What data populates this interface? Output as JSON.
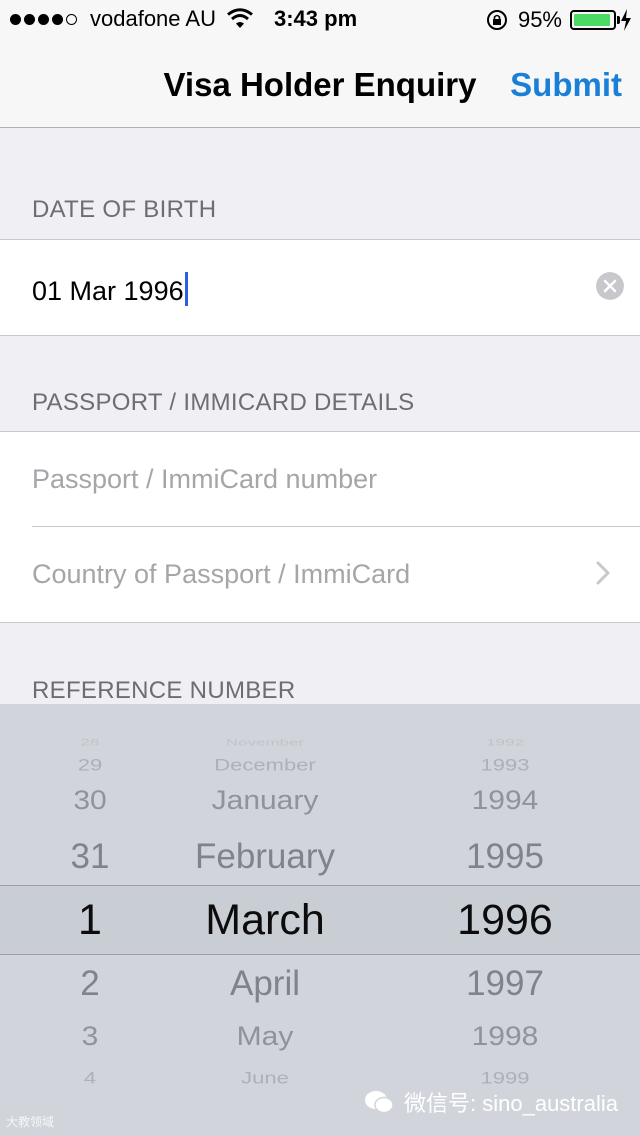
{
  "status_bar": {
    "carrier": "vodafone AU",
    "time": "3:43 pm",
    "battery_percent": "95%",
    "battery_level": 0.95,
    "signal_bars": 4,
    "signal_max": 5,
    "icons": [
      "signal-dots-icon",
      "wifi-icon",
      "rotation-lock-icon",
      "battery-icon",
      "charging-bolt-icon"
    ]
  },
  "nav": {
    "title": "Visa Holder Enquiry",
    "submit_label": "Submit",
    "accent_color": "#1a7fd6"
  },
  "sections": {
    "dob": {
      "header": "DATE OF BIRTH",
      "value": "01 Mar 1996",
      "clear_icon": "clear-icon"
    },
    "passport": {
      "header": "PASSPORT / IMMICARD DETAILS",
      "number_placeholder": "Passport / ImmiCard number",
      "country_placeholder": "Country of Passport / ImmiCard",
      "chevron_icon": "chevron-right-icon"
    },
    "reference": {
      "header": "REFERENCE NUMBER"
    }
  },
  "picker": {
    "days": [
      "28",
      "29",
      "30",
      "31",
      "1",
      "2",
      "3",
      "4"
    ],
    "months": [
      "November",
      "December",
      "January",
      "February",
      "March",
      "April",
      "May",
      "June"
    ],
    "years": [
      "1992",
      "1993",
      "1994",
      "1995",
      "1996",
      "1997",
      "1998",
      "1999"
    ],
    "selected": {
      "day": "1",
      "month": "March",
      "year": "1996"
    }
  },
  "watermarks": {
    "left": "大教领域",
    "right": "微信号: sino_australia"
  }
}
